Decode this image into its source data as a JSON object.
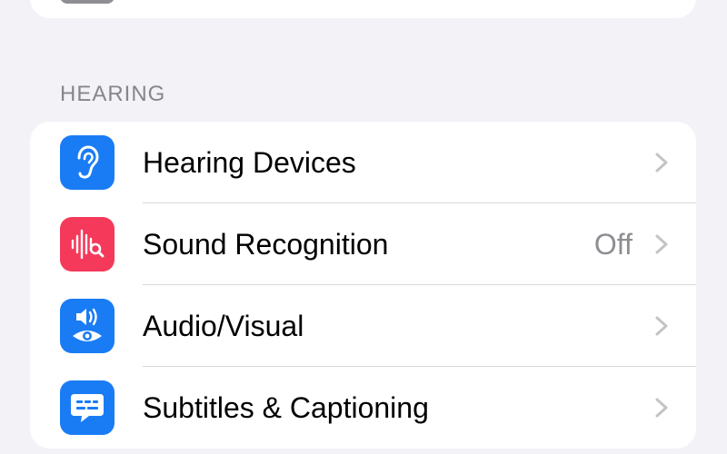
{
  "section": {
    "title": "HEARING"
  },
  "rows": [
    {
      "label": "Hearing Devices",
      "value": "",
      "icon": "ear-icon",
      "icon_color": "#1a7cf5"
    },
    {
      "label": "Sound Recognition",
      "value": "Off",
      "icon": "sound-recognition-icon",
      "icon_color": "#f5395a"
    },
    {
      "label": "Audio/Visual",
      "value": "",
      "icon": "audio-visual-icon",
      "icon_color": "#1a7cf5"
    },
    {
      "label": "Subtitles & Captioning",
      "value": "",
      "icon": "captions-icon",
      "icon_color": "#1a7cf5"
    }
  ],
  "colors": {
    "background": "#f2f2f7",
    "card": "#ffffff",
    "secondary_text": "#8e8e93",
    "chevron": "#c4c4c7"
  }
}
